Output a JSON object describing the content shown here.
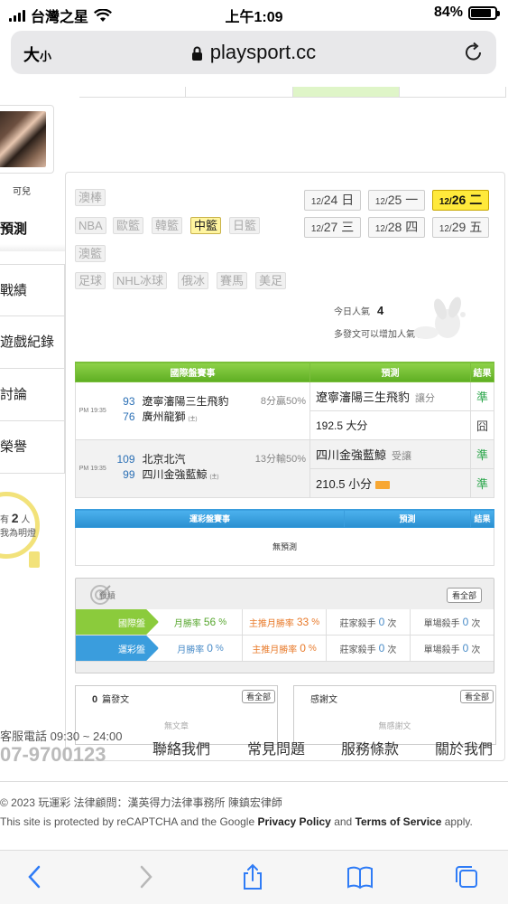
{
  "status": {
    "carrier": "台灣之星",
    "time": "上午1:09",
    "battery": "84%"
  },
  "urlbar": {
    "text_size": "大",
    "text_size_small": "小",
    "url": "playsport.cc"
  },
  "user": {
    "name": "可兒"
  },
  "leftnav": {
    "title": "預測",
    "items": [
      "戰績",
      "遊戲紀錄",
      "討論",
      "榮譽"
    ]
  },
  "bulb": {
    "pre": "有",
    "count": "2",
    "unit": "人",
    "text": "我為明燈"
  },
  "sports": {
    "row1": [
      "澳棒"
    ],
    "row2": [
      "NBA",
      "歐籃",
      "韓籃",
      "中籃",
      "日籃"
    ],
    "row3": [
      "澳籃"
    ],
    "row4": [
      "足球",
      "NHL冰球",
      "俄冰",
      "賽馬",
      "美足"
    ],
    "selected": "中籃"
  },
  "dates": [
    {
      "md": "12/",
      "d": "24",
      "w": "日"
    },
    {
      "md": "12/",
      "d": "25",
      "w": "一"
    },
    {
      "md": "12/",
      "d": "26",
      "w": "二"
    },
    {
      "md": "12/",
      "d": "27",
      "w": "三"
    },
    {
      "md": "12/",
      "d": "28",
      "w": "四"
    },
    {
      "md": "12/",
      "d": "29",
      "w": "五"
    }
  ],
  "selected_date": "12/26",
  "popularity": {
    "label": "今日人氣",
    "value": "4",
    "tip": "多發文可以增加人氣哦~"
  },
  "intl": {
    "headers": [
      "國際盤賽事",
      "預測",
      "結果"
    ],
    "games": [
      {
        "time": "PM 19:35",
        "away_score": "93",
        "away": "遼寧瀋陽三生飛豹",
        "home_score": "76",
        "home": "廣州龍獅",
        "home_tag": "(主)",
        "spread": "8分贏50%",
        "preds": [
          {
            "text": "遼寧瀋陽三生飛豹",
            "sub": "讓分",
            "result": "準"
          },
          {
            "text": "192.5 大分",
            "sub": "",
            "result": "囧"
          }
        ]
      },
      {
        "time": "PM 19:35",
        "away_score": "109",
        "away": "北京北汽",
        "home_score": "99",
        "home": "四川金強藍鯨",
        "home_tag": "(主)",
        "spread": "13分輸50%",
        "preds": [
          {
            "text": "四川金強藍鯨",
            "sub": "受讓",
            "result": "準"
          },
          {
            "text": "210.5 小分",
            "sub": "",
            "result": "準"
          }
        ]
      }
    ]
  },
  "local": {
    "headers": [
      "運彩盤賽事",
      "預測",
      "結果"
    ],
    "empty": "無預測"
  },
  "record": {
    "title": "戰績",
    "more": "看全部",
    "rows": [
      {
        "label": "國際盤",
        "month_rate_label": "月勝率",
        "month_rate": "56",
        "main_rate_label": "主推月勝率",
        "main_rate": "33",
        "pct": "%",
        "house_label": "莊家殺手",
        "house": "0",
        "single_label": "單場殺手",
        "single": "0",
        "times": "次"
      },
      {
        "label": "運彩盤",
        "month_rate_label": "月勝率",
        "month_rate": "0",
        "main_rate_label": "主推月勝率",
        "main_rate": "0",
        "pct": "%",
        "house_label": "莊家殺手",
        "house": "0",
        "single_label": "單場殺手",
        "single": "0",
        "times": "次"
      }
    ]
  },
  "posts": {
    "count": "0",
    "label": "篇發文",
    "more": "看全部",
    "empty": "無文章"
  },
  "thanks": {
    "label": "感謝文",
    "more": "看全部",
    "empty": "無感謝文"
  },
  "footer": {
    "phone_label": "客服電話 09:30 ~ 24:00",
    "phone": "07-9700123",
    "links": [
      "聯絡我們",
      "常見問題",
      "服務條款",
      "關於我們"
    ],
    "copyright": "© 2023 玩運彩 法律顧問：漢英得力法律事務所 陳鎮宏律師",
    "recaptcha_pre": "This site is protected by reCAPTCHA and the Google ",
    "privacy": "Privacy Policy",
    "and": " and ",
    "terms": "Terms of Service",
    "apply": " apply."
  },
  "colors": {
    "green": "#5eae22",
    "blue": "#2a8fd0",
    "yellow": "#ffe93b",
    "correct": "#2aa64a"
  }
}
